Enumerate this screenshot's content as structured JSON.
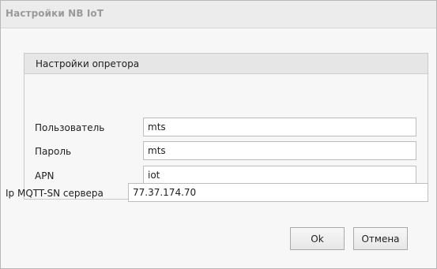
{
  "dialog": {
    "title": "Настройки NB IoT"
  },
  "operator_group": {
    "title": "Настройки опретора",
    "fields": [
      {
        "label": "Пользователь",
        "value": "mts"
      },
      {
        "label": "Пароль",
        "value": "mts"
      },
      {
        "label": "APN",
        "value": "iot"
      }
    ]
  },
  "server": {
    "label": "Ip MQTT-SN сервера",
    "value": "77.37.174.70"
  },
  "buttons": {
    "ok_label": "Ok",
    "cancel_label": "Отмена"
  }
}
